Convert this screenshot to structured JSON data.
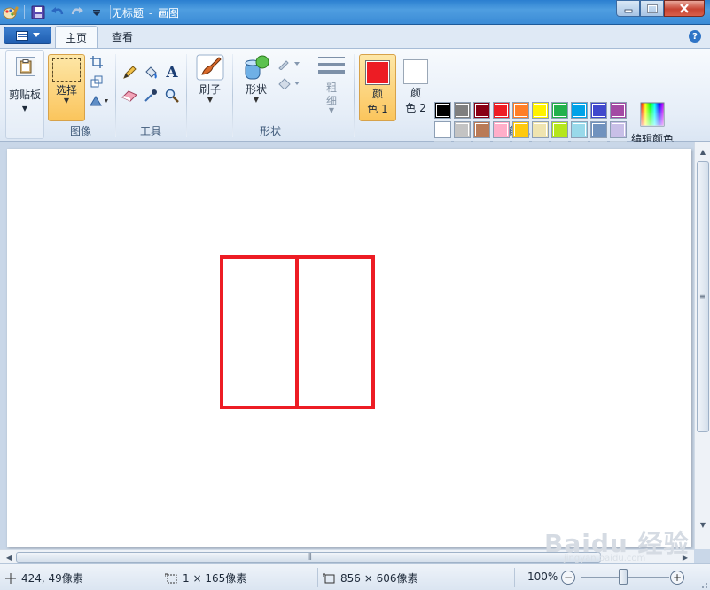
{
  "window": {
    "title": "无标题",
    "app_name": "画图",
    "title_separator": "-"
  },
  "tabs": [
    {
      "label": "主页"
    },
    {
      "label": "查看"
    }
  ],
  "ribbon": {
    "clipboard": {
      "label": "剪贴板"
    },
    "image": {
      "select_label": "选择",
      "group_label": "图像"
    },
    "tools": {
      "group_label": "工具"
    },
    "brushes": {
      "label": "刷子"
    },
    "shapes": {
      "label": "形状",
      "group_label": "形状"
    },
    "size": {
      "label_1": "粗",
      "label_2": "细"
    },
    "colors": {
      "color1_l1": "颜",
      "color1_l2": "色 1",
      "color2_l1": "颜",
      "color2_l2": "色 2",
      "edit_label": "编辑颜色",
      "group_label": "颜色",
      "color1_value": "#ed1c24",
      "color2_value": "#ffffff",
      "palette_row1": [
        "#000000",
        "#7f7f7f",
        "#880015",
        "#ed1c24",
        "#ff7f27",
        "#fff200",
        "#22b14c",
        "#00a2e8",
        "#3f48cc",
        "#a349a4"
      ],
      "palette_row2": [
        "#ffffff",
        "#c3c3c3",
        "#b97a57",
        "#ffaec9",
        "#ffc90e",
        "#efe4b0",
        "#b5e61d",
        "#99d9ea",
        "#7092be",
        "#c8bfe7"
      ]
    }
  },
  "canvas": {
    "stroke_color": "#ed1c24"
  },
  "status": {
    "cursor_pos": "424, 49像素",
    "selection_size": "1 × 165像素",
    "image_size": "856 × 606像素",
    "zoom": "100%",
    "zoom_minus": "−",
    "zoom_plus": "+"
  },
  "watermark": {
    "text": "Baidu 经验",
    "sub": "jingyan.baidu.com"
  }
}
